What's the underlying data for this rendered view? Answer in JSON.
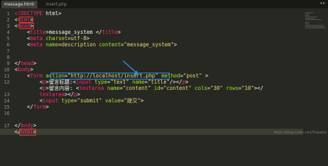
{
  "tabs": [
    {
      "label": "message.html",
      "active": true
    },
    {
      "label": "insert.php",
      "active": false
    }
  ],
  "tabbar_arrows": "◂ ▸",
  "line_numbers": [
    "1",
    "2",
    "3",
    "4",
    "5",
    "6",
    "7",
    "8",
    "9",
    "10",
    "11",
    "12",
    "13",
    "14",
    "15",
    "16",
    "17",
    "18"
  ],
  "code": {
    "l1_doctype": "<!DOCTYPE",
    "l1_rest": " html>",
    "l2_open": "<",
    "l2_tag": "html",
    "l2_close": ">",
    "l3_open": "<",
    "l3_tag": "head",
    "l3_close": ">",
    "l4_pre": "    <",
    "l4_tag": "title",
    "l4_text": ">message_system </",
    "l4_tag2": "title",
    "l4_end": ">",
    "l5_pre": "    <",
    "l5_tag": "meta",
    "l5_attr": " charset",
    "l5_eq": "=",
    "l5_val": "utf-8",
    "l5_end": ">",
    "l6_pre": "    <",
    "l6_tag": "meta",
    "l6_attr": " name",
    "l6_eq": "=",
    "l6_val": "description",
    "l6_attr2": " content",
    "l6_eq2": "=",
    "l6_val2": "\"message_system\"",
    "l6_end": ">",
    "l8_open": "</",
    "l8_tag": "head",
    "l8_close": ">",
    "l9_open": "<",
    "l9_tag": "body",
    "l9_close": ">",
    "l10_pre": "    <",
    "l10_tag": "form",
    "l10_attr": " action",
    "l10_eq": "=",
    "l10_val": "\"http://localhost/insert.php\"",
    "l10_attr2": " method",
    "l10_eq2": "=",
    "l10_val2": "\"post\"",
    "l10_end": " >",
    "l11_pre": "        <",
    "l11_tag": "p",
    "l11_text": ">留言标题:<",
    "l11_tag2": "input",
    "l11_attr": " type",
    "l11_eq": "=",
    "l11_val": "\"text\"",
    "l11_attr2": " name",
    "l11_eq2": "=",
    "l11_val2": "\"title\"",
    "l11_mid": "/></",
    "l11_tag3": "p",
    "l11_end": ">",
    "l12_pre": "        <",
    "l12_tag": "p",
    "l12_text": ">留言内容: <",
    "l12_tag2": "textarea",
    "l12_attr": " name",
    "l12_eq": "=",
    "l12_val": "\"content\"",
    "l12_attr2": " id",
    "l12_eq2": "=",
    "l12_val2": "\"content\"",
    "l12_attr3": " cols",
    "l12_eq3": "=",
    "l12_val3": "\"30\"",
    "l12_attr4": " rows",
    "l12_eq4": "=",
    "l12_val4": "\"10\"",
    "l12_end": "></",
    "l12w_tag": "textarea",
    "l12w_mid": "></",
    "l12w_tag2": "p",
    "l12w_end": ">",
    "l13_pre": "        <",
    "l13_tag": "input",
    "l13_attr": " type",
    "l13_eq": "=",
    "l13_val": "\"submit\"",
    "l13_attr2": " value",
    "l13_eq2": "=",
    "l13_val2": "\"提交\"",
    "l13_end": ">",
    "l14_pre": "    </",
    "l14_tag": "form",
    "l14_end": ">",
    "l17_open": "</",
    "l17_tag": "body",
    "l17_close": ">",
    "l18_open": "</",
    "l18_tag": "html",
    "l18_close": ">"
  },
  "watermark": "http://blog.csdn.net/Pubebe",
  "colors": {
    "background": "#272822",
    "tag": "#f92672",
    "attribute": "#a6e22e",
    "string": "#e6db74",
    "text": "#f8f8f2",
    "highlight_red": "#e03a2e",
    "highlight_blue": "#2b8ef0"
  }
}
